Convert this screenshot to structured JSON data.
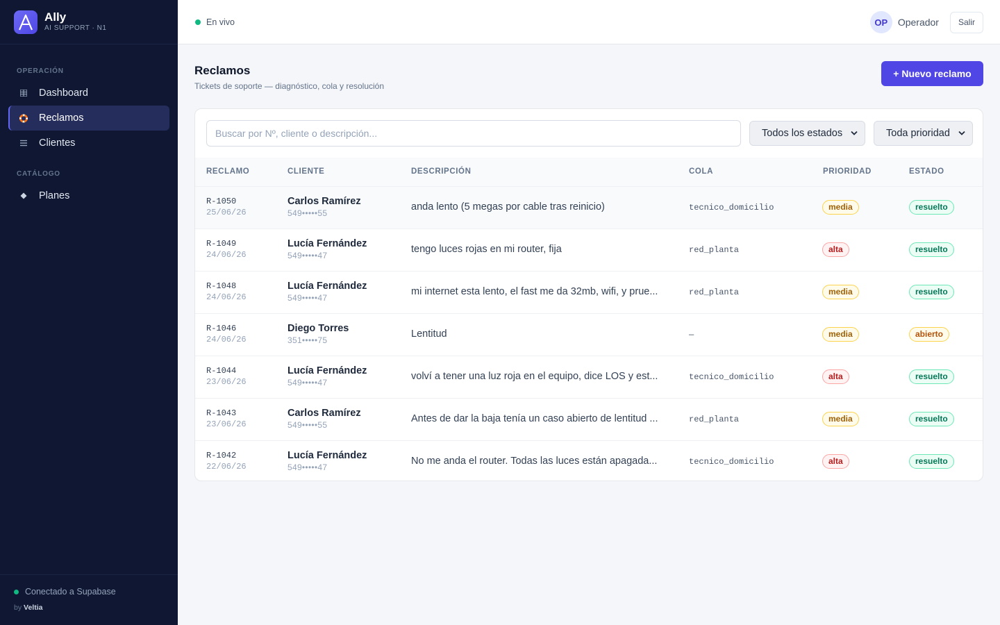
{
  "brand": {
    "name": "Ally",
    "sub": "AI SUPPORT · N1",
    "logo_letter": "A"
  },
  "sidebar": {
    "sections": [
      {
        "label": "OPERACIÓN"
      },
      {
        "label": "CATÁLOGO"
      }
    ],
    "items": [
      {
        "label": "Dashboard",
        "icon": "grid-icon"
      },
      {
        "label": "Reclamos",
        "icon": "lifebuoy-icon",
        "active": true
      },
      {
        "label": "Clientes",
        "icon": "list-icon"
      },
      {
        "label": "Planes",
        "icon": "diamond-icon"
      }
    ],
    "footer": {
      "status": "Conectado a Supabase",
      "by": "by",
      "by_brand": "Veltia"
    }
  },
  "topbar": {
    "live": "En vivo",
    "avatar": "OP",
    "user": "Operador",
    "logout": "Salir"
  },
  "page": {
    "title": "Reclamos",
    "subtitle": "Tickets de soporte — diagnóstico, cola y resolución",
    "new_button": "+ Nuevo reclamo"
  },
  "filters": {
    "search_placeholder": "Buscar por Nº, cliente o descripción...",
    "estado": "Todos los estados",
    "prioridad": "Toda prioridad"
  },
  "table": {
    "headers": [
      "RECLAMO",
      "CLIENTE",
      "DESCRIPCIÓN",
      "COLA",
      "PRIORIDAD",
      "ESTADO"
    ],
    "rows": [
      {
        "id": "R-1050",
        "date": "25/06/26",
        "client": "Carlos Ramírez",
        "phone": "549•••••55",
        "desc": "anda lento (5 megas por cable tras reinicio)",
        "cola": "tecnico_domicilio",
        "prioridad": "media",
        "estado": "resuelto"
      },
      {
        "id": "R-1049",
        "date": "24/06/26",
        "client": "Lucía Fernández",
        "phone": "549•••••47",
        "desc": "tengo luces rojas en mi router, fija",
        "cola": "red_planta",
        "prioridad": "alta",
        "estado": "resuelto"
      },
      {
        "id": "R-1048",
        "date": "24/06/26",
        "client": "Lucía Fernández",
        "phone": "549•••••47",
        "desc": "mi internet esta lento, el fast me da 32mb, wifi, y prue...",
        "cola": "red_planta",
        "prioridad": "media",
        "estado": "resuelto"
      },
      {
        "id": "R-1046",
        "date": "24/06/26",
        "client": "Diego Torres",
        "phone": "351•••••75",
        "desc": "Lentitud",
        "cola": "—",
        "prioridad": "media",
        "estado": "abierto"
      },
      {
        "id": "R-1044",
        "date": "23/06/26",
        "client": "Lucía Fernández",
        "phone": "549•••••47",
        "desc": "volví a tener una luz roja en el equipo, dice LOS y est...",
        "cola": "tecnico_domicilio",
        "prioridad": "alta",
        "estado": "resuelto"
      },
      {
        "id": "R-1043",
        "date": "23/06/26",
        "client": "Carlos Ramírez",
        "phone": "549•••••55",
        "desc": "Antes de dar la baja tenía un caso abierto de lentitud ...",
        "cola": "red_planta",
        "prioridad": "media",
        "estado": "resuelto"
      },
      {
        "id": "R-1042",
        "date": "22/06/26",
        "client": "Lucía Fernández",
        "phone": "549•••••47",
        "desc": "No me anda el router. Todas las luces están apagada...",
        "cola": "tecnico_domicilio",
        "prioridad": "alta",
        "estado": "resuelto"
      }
    ]
  },
  "colors": {
    "accent": "#4f46e5",
    "sidebar_bg": "#0f1733",
    "live": "#10b981"
  }
}
